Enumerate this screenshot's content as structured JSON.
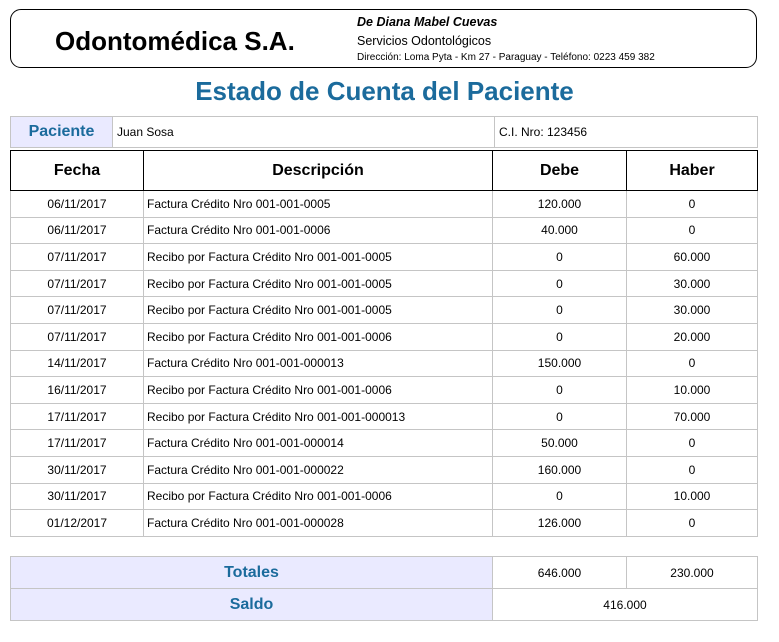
{
  "header": {
    "company": "Odontomédica S.A.",
    "owner": "De Diana Mabel Cuevas",
    "services": "Servicios Odontológicos",
    "address": "Dirección: Loma Pyta - Km 27 - Paraguay  -  Teléfono: 0223 459 382"
  },
  "title": "Estado de Cuenta del Paciente",
  "patient": {
    "label": "Paciente",
    "name": "Juan Sosa",
    "ci": "C.I. Nro: 123456"
  },
  "table": {
    "columns": [
      "Fecha",
      "Descripción",
      "Debe",
      "Haber"
    ],
    "rows": [
      [
        "06/11/2017",
        "Factura Crédito Nro 001-001-0005",
        "120.000",
        "0"
      ],
      [
        "06/11/2017",
        "Factura Crédito Nro 001-001-0006",
        "40.000",
        "0"
      ],
      [
        "07/11/2017",
        "Recibo por Factura Crédito Nro 001-001-0005",
        "0",
        "60.000"
      ],
      [
        "07/11/2017",
        "Recibo por Factura Crédito Nro 001-001-0005",
        "0",
        "30.000"
      ],
      [
        "07/11/2017",
        "Recibo por Factura Crédito Nro 001-001-0005",
        "0",
        "30.000"
      ],
      [
        "07/11/2017",
        "Recibo por Factura Crédito Nro 001-001-0006",
        "0",
        "20.000"
      ],
      [
        "14/11/2017",
        "Factura Crédito Nro 001-001-000013",
        "150.000",
        "0"
      ],
      [
        "16/11/2017",
        "Recibo por Factura Crédito Nro 001-001-0006",
        "0",
        "10.000"
      ],
      [
        "17/11/2017",
        "Recibo por Factura Crédito Nro 001-001-000013",
        "0",
        "70.000"
      ],
      [
        "17/11/2017",
        "Factura Crédito Nro 001-001-000014",
        "50.000",
        "0"
      ],
      [
        "30/11/2017",
        "Factura Crédito Nro 001-001-000022",
        "160.000",
        "0"
      ],
      [
        "30/11/2017",
        "Recibo por Factura Crédito Nro 001-001-0006",
        "0",
        "10.000"
      ],
      [
        "01/12/2017",
        "Factura Crédito Nro 001-001-000028",
        "126.000",
        "0"
      ]
    ]
  },
  "totals": {
    "label": "Totales",
    "debe": "646.000",
    "haber": "230.000"
  },
  "saldo": {
    "label": "Saldo",
    "value": "416.000"
  }
}
